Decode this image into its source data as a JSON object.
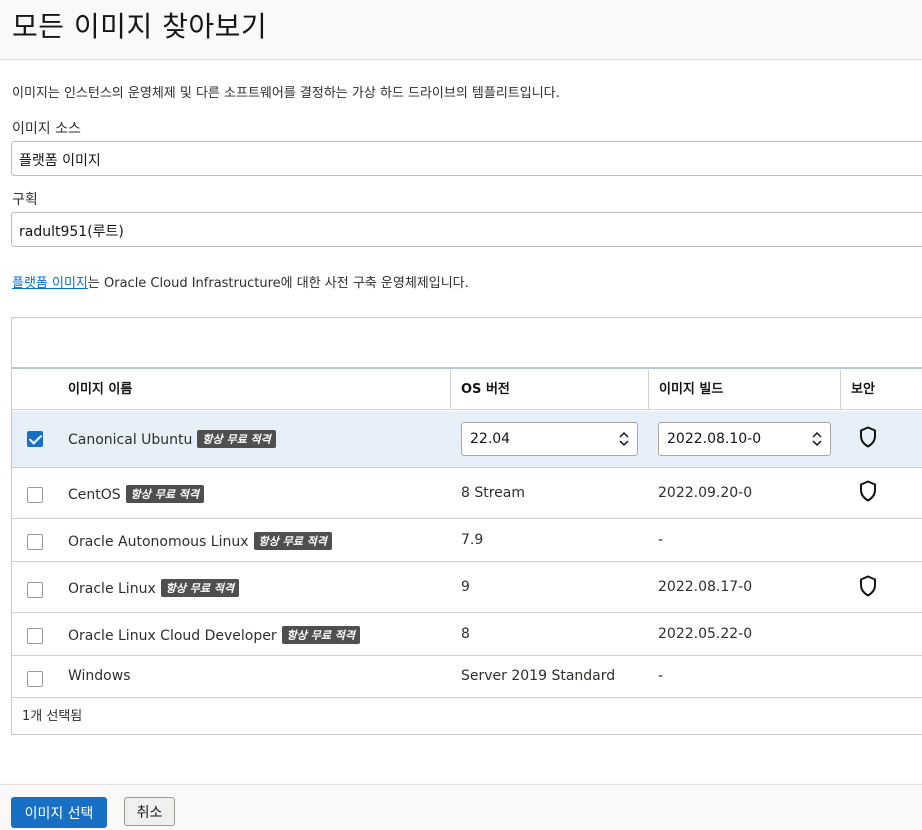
{
  "page": {
    "title": "모든 이미지 찾아보기",
    "intro": "이미지는 인스턴스의 운영체제 및 다른 소프트웨어를 결정하는 가상 하드 드라이브의 템플리트입니다."
  },
  "fields": {
    "image_source_label": "이미지 소스",
    "image_source_value": "플랫폼 이미지",
    "compartment_label": "구획",
    "compartment_value": "radult951(루트)"
  },
  "platform_desc": {
    "link": "플랫폼 이미지",
    "text": "는 Oracle Cloud Infrastructure에 대한 사전 구축 운영체제입니다."
  },
  "table": {
    "headers": {
      "name": "이미지 이름",
      "os_version": "OS 버전",
      "build": "이미지 빌드",
      "security": "보안"
    },
    "badge": "항상 무료 적격",
    "rows": [
      {
        "name": "Canonical Ubuntu",
        "badge": true,
        "os_version": "22.04",
        "build": "2022.08.10-0",
        "secure": true,
        "selected": true
      },
      {
        "name": "CentOS",
        "badge": true,
        "os_version": "8 Stream",
        "build": "2022.09.20-0",
        "secure": true,
        "selected": false
      },
      {
        "name": "Oracle Autonomous Linux",
        "badge": true,
        "os_version": "7.9",
        "build": "-",
        "secure": false,
        "selected": false
      },
      {
        "name": "Oracle Linux",
        "badge": true,
        "os_version": "9",
        "build": "2022.08.17-0",
        "secure": true,
        "selected": false
      },
      {
        "name": "Oracle Linux Cloud Developer",
        "badge": true,
        "os_version": "8",
        "build": "2022.05.22-0",
        "secure": false,
        "selected": false
      },
      {
        "name": "Windows",
        "badge": false,
        "os_version": "Server 2019 Standard",
        "build": "-",
        "secure": false,
        "selected": false
      }
    ],
    "selected_count": "1개 선택됨"
  },
  "footer": {
    "select_button": "이미지 선택",
    "cancel_button": "취소"
  },
  "colors": {
    "primary": "#1770c4",
    "selected_row": "#e7f0f8",
    "badge": "#4f4f4f",
    "link": "#0572ce"
  }
}
